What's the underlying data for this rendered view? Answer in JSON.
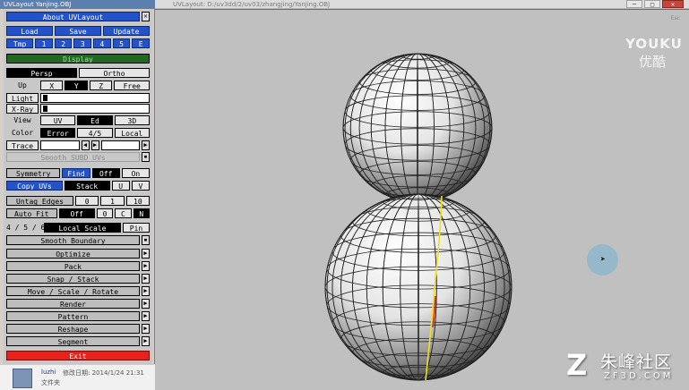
{
  "panel": {
    "title": "UVLayout Yanjing.OBJ",
    "header": "About UVLayout",
    "file_row": {
      "load": "Load",
      "save": "Save",
      "update": "Update"
    },
    "tmp_row": {
      "label": "Tmp",
      "slots": [
        "1",
        "2",
        "3",
        "4",
        "5",
        "E"
      ]
    },
    "display": "Display",
    "proj_row": {
      "persp": "Persp",
      "ortho": "Ortho"
    },
    "up_row": {
      "label": "Up",
      "x": "X",
      "y": "Y",
      "z": "Z",
      "free": "Free"
    },
    "light_label": "Light",
    "xray_label": "X-Ray",
    "view_row": {
      "label": "View",
      "uv": "UV",
      "ed": "Ed",
      "3d": "3D"
    },
    "color_row": {
      "label": "Color",
      "error": "Error",
      "ratio": "4/5",
      "local": "Local"
    },
    "trace_label": "Trace",
    "smooth_subd": "Smooth SUBD UVs",
    "symmetry_row": {
      "label": "Symmetry",
      "find": "Find",
      "off": "Off",
      "on": "On"
    },
    "copy_row": {
      "label": "Copy UVs",
      "stack": "Stack",
      "u": "U",
      "v": "V"
    },
    "untag_row": {
      "label": "Untag Edges",
      "a": "0",
      "b": "1",
      "c": "10"
    },
    "autofit_row": {
      "label": "Auto Fit",
      "off": "Off",
      "a": "0",
      "c": "C",
      "n": "N"
    },
    "scale_row": {
      "label": "4 / 5 / 6",
      "local_scale": "Local Scale",
      "pin": "Pin"
    },
    "smooth_boundary": "Smooth Boundary",
    "menus": [
      "Optimize",
      "Pack",
      "Snap / Stack",
      "Move / Scale / Rotate",
      "Render",
      "Pattern",
      "Reshape",
      "Segment"
    ],
    "exit": "Exit"
  },
  "fileinfo": {
    "name": "luzhi",
    "modified": "修改日期: 2014/1/24 21:31",
    "type": "文件夹"
  },
  "viewport": {
    "title": "UVLayout: D:/uv3dd/2/uv03/zhangjing/Yanjing.OBJ",
    "exit_label": "Esc",
    "controls": {
      "minimize": "─",
      "maximize": "□",
      "close": "✕"
    }
  },
  "watermarks": {
    "youku_en": "YOUKU",
    "youku_cn": "优酷",
    "zf_cn": "朱峰社区",
    "zf_domain": "ZF3D.COM"
  },
  "colors": {
    "accent_blue": "#2452c8",
    "exit_red": "#e8221a",
    "seam_yellow": "#f0e020",
    "seam_red": "#e03010"
  }
}
